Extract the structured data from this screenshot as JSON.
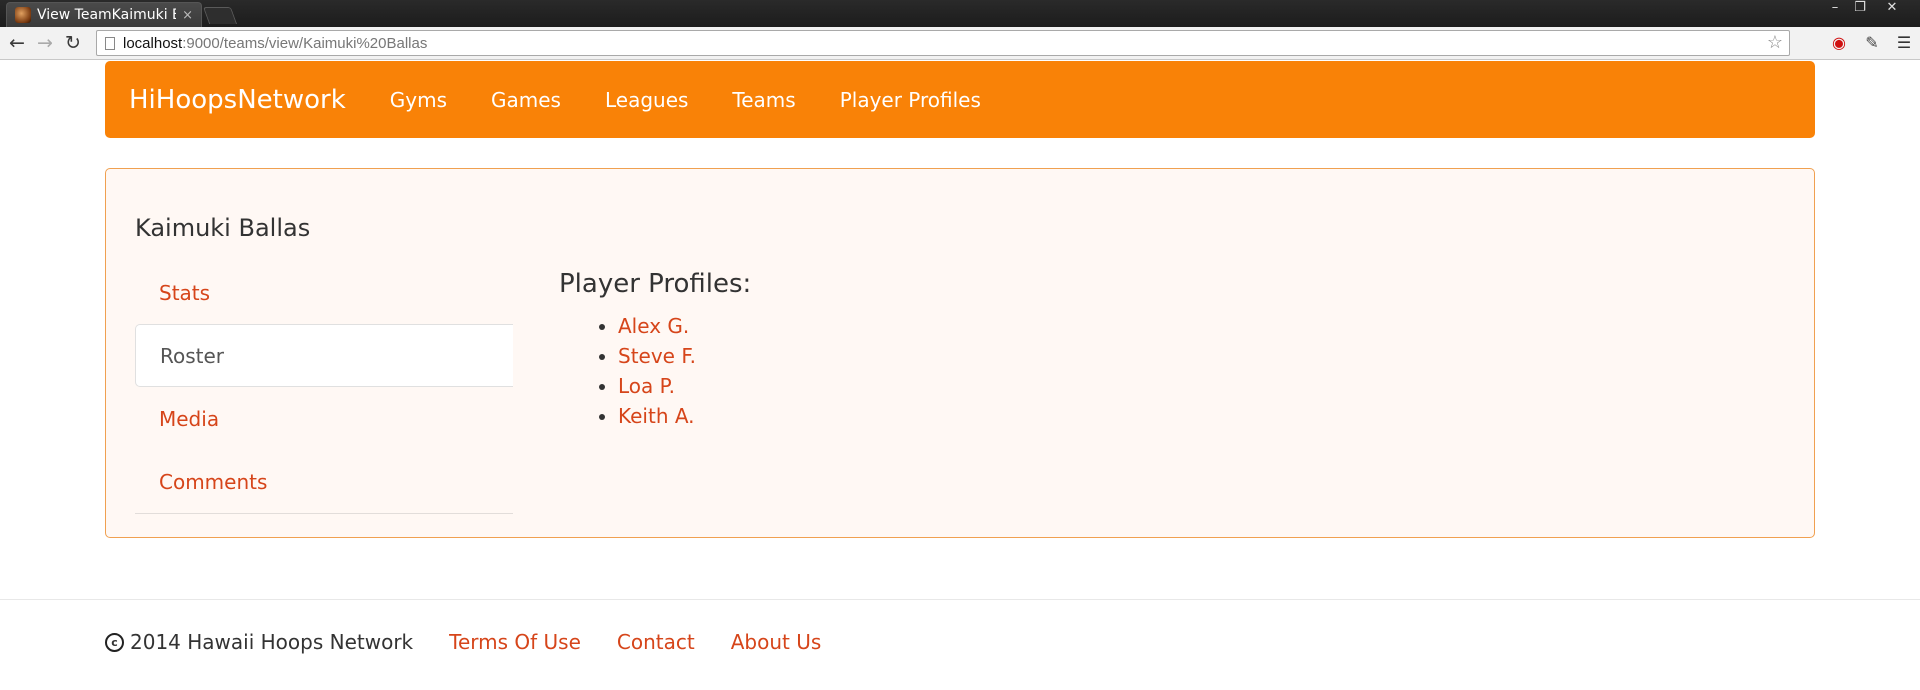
{
  "browser": {
    "tab_title": "View TeamKaimuki B",
    "tab_close": "×",
    "url_host": "localhost",
    "url_path": ":9000/teams/view/Kaimuki%20Ballas",
    "win_minimize": "–",
    "win_restore": "❐",
    "win_close": "✕"
  },
  "site": {
    "brand": "HiHoopsNetwork",
    "nav": [
      "Gyms",
      "Games",
      "Leagues",
      "Teams",
      "Player Profiles"
    ],
    "accent_color": "#f98207",
    "link_color": "#d6451a"
  },
  "team": {
    "name": "Kaimuki Ballas",
    "tabs": [
      "Stats",
      "Roster",
      "Media",
      "Comments"
    ],
    "active_tab": "Roster",
    "roster_heading": "Player Profiles:",
    "players": [
      "Alex G.",
      "Steve F.",
      "Loa P.",
      "Keith A."
    ]
  },
  "footer": {
    "copyright_symbol": "c",
    "copyright": "2014 Hawaii Hoops Network",
    "links": [
      "Terms Of Use",
      "Contact",
      "About Us"
    ]
  }
}
